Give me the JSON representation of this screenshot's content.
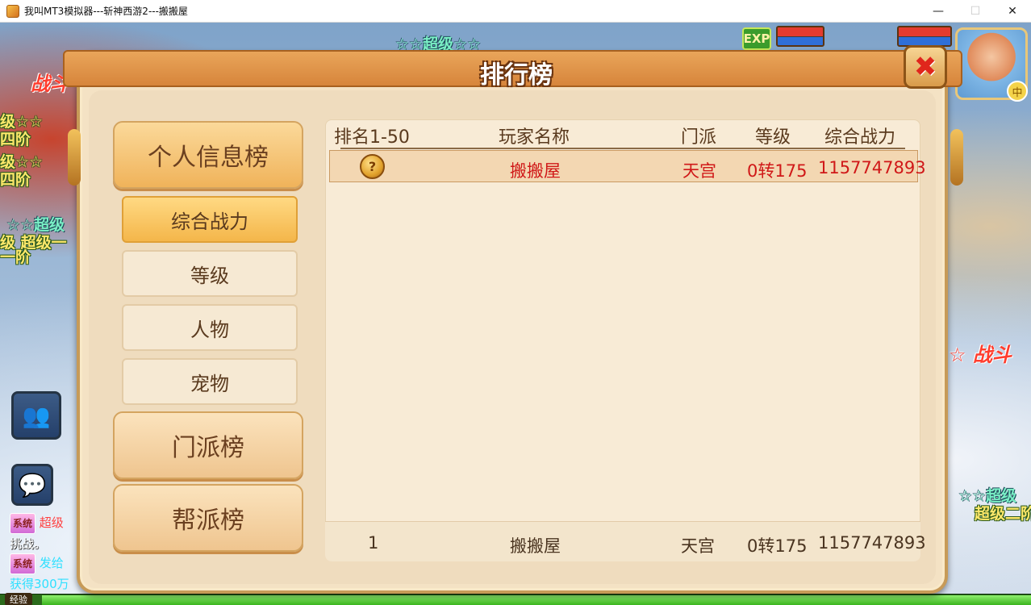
{
  "window": {
    "title": "我叫MT3模拟器---斩神西游2---搬搬屋",
    "minimize": "—",
    "maximize": "☐",
    "close": "✕"
  },
  "background": {
    "texts": [
      "☆☆超级☆☆",
      "战斗",
      "级☆☆",
      "四阶",
      "级☆☆",
      "四阶",
      "☆☆超级",
      "级 超级一",
      "一阶",
      "☆ 战斗",
      "☆☆超级",
      "超级二阶"
    ]
  },
  "hud": {
    "exp_badge": "EXP",
    "avatar_badge": "中",
    "exp_label": "经验"
  },
  "side_buttons": {
    "friends_icon": "👥",
    "chat_icon": "💬"
  },
  "chat": {
    "line1_tag": "系统",
    "line1_text": "超级",
    "line2_text": "挑战。",
    "line3_tag": "系统",
    "line3_text": "发给",
    "line4_text": "获得300万"
  },
  "panel": {
    "title": "排行榜",
    "close_icon": "✖"
  },
  "categories": {
    "personal": "个人信息榜",
    "sub_power": "综合战力",
    "sub_level": "等级",
    "sub_character": "人物",
    "sub_pet": "宠物",
    "sect": "门派榜",
    "guild": "帮派榜"
  },
  "table": {
    "headers": {
      "rank": "排名1-50",
      "name": "玩家名称",
      "sect": "门派",
      "level": "等级",
      "power": "综合战力"
    },
    "rows": [
      {
        "rank_icon": "?",
        "name": "搬搬屋",
        "sect": "天宫",
        "level": "0转175",
        "power": "1157747893"
      }
    ],
    "self": {
      "rank": "1",
      "name": "搬搬屋",
      "sect": "天宫",
      "level": "0转175",
      "power": "1157747893"
    }
  }
}
